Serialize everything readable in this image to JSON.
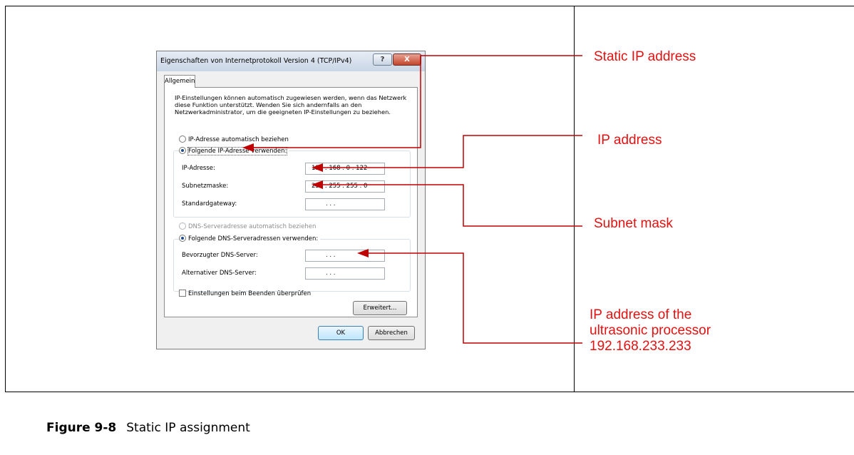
{
  "dialog": {
    "title": "Eigenschaften von Internetprotokoll Version 4 (TCP/IPv4)",
    "help_label": "?",
    "close_label": "X",
    "tab_label": "Allgemein",
    "intro_text": "IP-Einstellungen können automatisch zugewiesen werden, wenn das Netzwerk diese Funktion unterstützt. Wenden Sie sich andernfalls an den Netzwerkadministrator, um die geeigneten IP-Einstellungen zu beziehen.",
    "radio_auto_ip": "IP-Adresse automatisch beziehen",
    "radio_static_ip": "Folgende IP-Adresse verwenden:",
    "ip_address_label": "IP-Adresse:",
    "ip_address_value": "192 . 168 .   0   . 122",
    "subnet_label": "Subnetzmaske:",
    "subnet_value": "255 . 255 . 255 .   0",
    "gateway_label": "Standardgateway:",
    "gateway_value": ".       .       .",
    "radio_auto_dns": "DNS-Serveradresse automatisch beziehen",
    "radio_static_dns": "Folgende DNS-Serveradressen verwenden:",
    "preferred_dns_label": "Bevorzugter DNS-Server:",
    "preferred_dns_value": ".       .       .",
    "alternate_dns_label": "Alternativer DNS-Server:",
    "alternate_dns_value": ".       .       .",
    "validate_checkbox_label": "Einstellungen beim Beenden überprüfen",
    "advanced_button": "Erweitert...",
    "ok_button": "OK",
    "cancel_button": "Abbrechen"
  },
  "annotations": {
    "static_ip": "Static IP address",
    "ip_address": "IP address",
    "subnet_mask": "Subnet mask",
    "processor_ip_line1": "IP address of the",
    "processor_ip_line2": "ultrasonic processor",
    "processor_ip_line3": "192.168.233.233",
    "color": "#e31212"
  },
  "caption": {
    "label": "Figure 9-8",
    "text": "Static IP assignment"
  }
}
